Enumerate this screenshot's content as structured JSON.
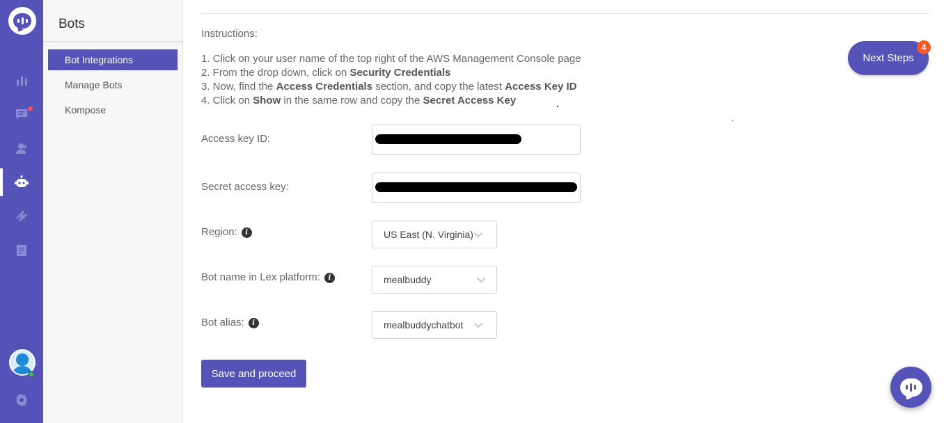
{
  "app": {
    "section_title": "Bots"
  },
  "sidebar": {
    "items": [
      {
        "label": "Bot Integrations",
        "active": true
      },
      {
        "label": "Manage Bots",
        "active": false
      },
      {
        "label": "Kompose",
        "active": false
      }
    ]
  },
  "rail": {
    "icons": [
      "logo-icon",
      "analytics-icon",
      "conversations-icon",
      "users-icon",
      "bot-icon",
      "integrations-icon",
      "reports-icon",
      "settings-icon"
    ],
    "notification_dot_color": "#f0506e"
  },
  "form": {
    "instructions_label": "Instructions:",
    "steps": [
      {
        "prefix": "1. Click on your user name of the top right of the AWS Management Console page",
        "bold": "",
        "middle": "",
        "bold2": "",
        "suffix": ""
      },
      {
        "prefix": "2. From the drop down, click on ",
        "bold": "Security Credentials",
        "middle": "",
        "bold2": "",
        "suffix": ""
      },
      {
        "prefix": "3. Now, find the ",
        "bold": "Access Credentials",
        "middle": " section, and copy the latest ",
        "bold2": "Access Key ID",
        "suffix": ""
      },
      {
        "prefix": "4. Click on ",
        "bold": "Show",
        "middle": " in the same row and copy the ",
        "bold2": "Secret Access Key",
        "suffix": ""
      }
    ],
    "access_key_label": "Access key ID:",
    "secret_key_label": "Secret access key:",
    "region_label": "Region:",
    "region_value": "US East (N. Virginia)",
    "bot_name_label": "Bot name in Lex platform:",
    "bot_name_value": "mealbuddy",
    "bot_alias_label": "Bot alias:",
    "bot_alias_value": "mealbuddychatbot",
    "save_label": "Save and proceed"
  },
  "next_steps": {
    "label": "Next Steps",
    "badge": "4"
  },
  "colors": {
    "brand": "#5553b7",
    "badge": "#f25a28",
    "online": "#2ecc40"
  }
}
